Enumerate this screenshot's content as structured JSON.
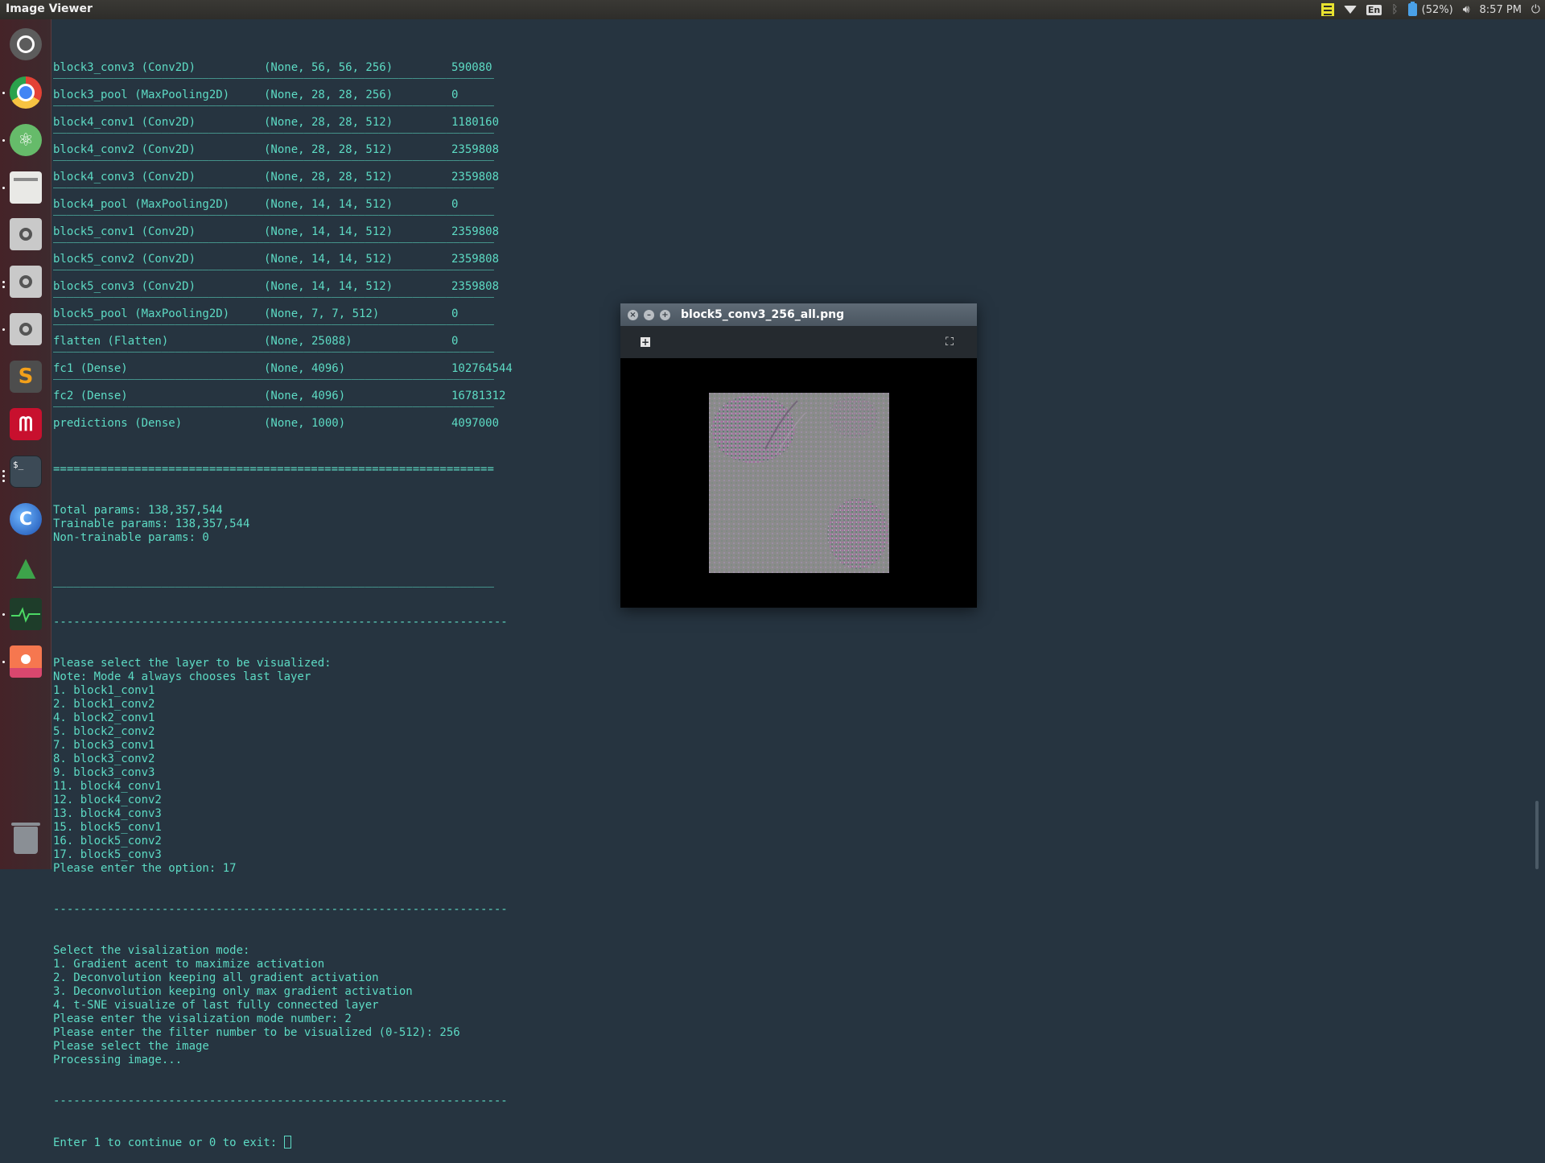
{
  "topbar": {
    "app_title": "Image Viewer",
    "keyboard": "En",
    "battery": "(52%)",
    "clock": "8:57 PM"
  },
  "launcher": {
    "icons": [
      "dash-icon",
      "chrome-icon",
      "atom-icon",
      "files-icon",
      "disk-icon",
      "disk-icon",
      "disk-icon",
      "sublime-icon",
      "mendeley-icon",
      "terminal-icon",
      "globe-icon",
      "rocket-icon",
      "system-monitor-icon",
      "image-viewer-icon",
      "trash-icon"
    ],
    "terminal_glyph": "$_"
  },
  "terminal": {
    "rows": [
      {
        "layer": "block3_conv3 (Conv2D)",
        "shape": "(None, 56, 56, 256)",
        "params": "590080"
      },
      {
        "layer": "block3_pool (MaxPooling2D)",
        "shape": "(None, 28, 28, 256)",
        "params": "0"
      },
      {
        "layer": "block4_conv1 (Conv2D)",
        "shape": "(None, 28, 28, 512)",
        "params": "1180160"
      },
      {
        "layer": "block4_conv2 (Conv2D)",
        "shape": "(None, 28, 28, 512)",
        "params": "2359808"
      },
      {
        "layer": "block4_conv3 (Conv2D)",
        "shape": "(None, 28, 28, 512)",
        "params": "2359808"
      },
      {
        "layer": "block4_pool (MaxPooling2D)",
        "shape": "(None, 14, 14, 512)",
        "params": "0"
      },
      {
        "layer": "block5_conv1 (Conv2D)",
        "shape": "(None, 14, 14, 512)",
        "params": "2359808"
      },
      {
        "layer": "block5_conv2 (Conv2D)",
        "shape": "(None, 14, 14, 512)",
        "params": "2359808"
      },
      {
        "layer": "block5_conv3 (Conv2D)",
        "shape": "(None, 14, 14, 512)",
        "params": "2359808"
      },
      {
        "layer": "block5_pool (MaxPooling2D)",
        "shape": "(None, 7, 7, 512)",
        "params": "0"
      },
      {
        "layer": "flatten (Flatten)",
        "shape": "(None, 25088)",
        "params": "0"
      },
      {
        "layer": "fc1 (Dense)",
        "shape": "(None, 4096)",
        "params": "102764544"
      },
      {
        "layer": "fc2 (Dense)",
        "shape": "(None, 4096)",
        "params": "16781312"
      },
      {
        "layer": "predictions (Dense)",
        "shape": "(None, 1000)",
        "params": "4097000"
      }
    ],
    "row_separator": "_________________________________________________________________",
    "double_separator": "=================================================================",
    "summary": [
      "Total params: 138,357,544",
      "Trainable params: 138,357,544",
      "Non-trainable params: 0"
    ],
    "dash_separator": "-------------------------------------------------------------------",
    "prompt_lines": [
      "Please select the layer to be visualized:",
      "Note: Mode 4 always chooses last layer",
      "1. block1_conv1",
      "2. block1_conv2",
      "4. block2_conv1",
      "5. block2_conv2",
      "7. block3_conv1",
      "8. block3_conv2",
      "9. block3_conv3",
      "11. block4_conv1",
      "12. block4_conv2",
      "13. block4_conv3",
      "15. block5_conv1",
      "16. block5_conv2",
      "17. block5_conv3",
      "Please enter the option: 17"
    ],
    "mode_lines": [
      "Select the visalization mode:",
      "1. Gradient acent to maximize activation",
      "2. Deconvolution keeping all gradient activation",
      "3. Deconvolution keeping only max gradient activation",
      "4. t-SNE visualize of last fully connected layer",
      "Please enter the visalization mode number: 2",
      "Please enter the filter number to be visualized (0-512): 256",
      "Please select the image",
      "Processing image..."
    ],
    "final_prompt": "Enter 1 to continue or 0 to exit: "
  },
  "viewer": {
    "title": "block5_conv3_256_all.png",
    "buttons": {
      "close": "×",
      "minimize": "–",
      "maximize": "+"
    },
    "toolbar": {
      "add": "+",
      "fullscreen": "⛶"
    }
  }
}
